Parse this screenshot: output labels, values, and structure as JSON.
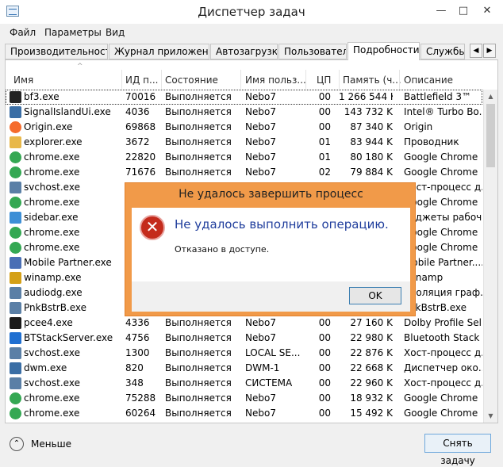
{
  "window": {
    "title": "Диспетчер задач",
    "min_glyph": "—",
    "max_glyph": "□",
    "close_glyph": "✕"
  },
  "menu": [
    "Файл",
    "Параметры",
    "Вид"
  ],
  "tabs": [
    "Производительность",
    "Журнал приложений",
    "Автозагрузка",
    "Пользователи",
    "Подробности",
    "Службы"
  ],
  "active_tab": "Подробности",
  "tab_scroll": {
    "left": "◀",
    "right": "▶"
  },
  "columns": [
    "Имя",
    "ИД п...",
    "Состояние",
    "Имя польз...",
    "ЦП",
    "Память (ч...",
    "Описание"
  ],
  "sort_glyph": "^",
  "rows": [
    {
      "name": "bf3.exe",
      "pid": "70016",
      "state": "Выполняется",
      "user": "Nebo7",
      "cpu": "00",
      "mem": "1 266 544 K",
      "desc": "Battlefield 3™",
      "icon": "bf3-icon",
      "color": "#222222"
    },
    {
      "name": "SignalIslandUi.exe",
      "pid": "4036",
      "state": "Выполняется",
      "user": "Nebo7",
      "cpu": "00",
      "mem": "143 732 K",
      "desc": "Intel® Turbo Bo...",
      "icon": "window-icon",
      "color": "#3a6ea5"
    },
    {
      "name": "Origin.exe",
      "pid": "69868",
      "state": "Выполняется",
      "user": "Nebo7",
      "cpu": "00",
      "mem": "87 340 K",
      "desc": "Origin",
      "icon": "origin-icon",
      "color": "#f56c2d"
    },
    {
      "name": "explorer.exe",
      "pid": "3672",
      "state": "Выполняется",
      "user": "Nebo7",
      "cpu": "01",
      "mem": "83 944 K",
      "desc": "Проводник",
      "icon": "folder-icon",
      "color": "#e8b84a"
    },
    {
      "name": "chrome.exe",
      "pid": "22820",
      "state": "Выполняется",
      "user": "Nebo7",
      "cpu": "01",
      "mem": "80 180 K",
      "desc": "Google Chrome",
      "icon": "chrome-icon",
      "color": "#34a853"
    },
    {
      "name": "chrome.exe",
      "pid": "71676",
      "state": "Выполняется",
      "user": "Nebo7",
      "cpu": "02",
      "mem": "79 884 K",
      "desc": "Google Chrome",
      "icon": "chrome-icon",
      "color": "#34a853"
    },
    {
      "name": "svchost.exe",
      "pid": "",
      "state": "",
      "user": "",
      "cpu": "",
      "mem": "",
      "desc": "Хост-процесс д...",
      "icon": "service-icon",
      "color": "#5a7fa6"
    },
    {
      "name": "chrome.exe",
      "pid": "",
      "state": "",
      "user": "",
      "cpu": "",
      "mem": "",
      "desc": "Google Chrome",
      "icon": "chrome-icon",
      "color": "#34a853"
    },
    {
      "name": "sidebar.exe",
      "pid": "",
      "state": "",
      "user": "",
      "cpu": "",
      "mem": "",
      "desc": "Гаджеты рабоч...",
      "icon": "sidebar-icon",
      "color": "#3d8fd6"
    },
    {
      "name": "chrome.exe",
      "pid": "",
      "state": "",
      "user": "",
      "cpu": "",
      "mem": "",
      "desc": "Google Chrome",
      "icon": "chrome-icon",
      "color": "#34a853"
    },
    {
      "name": "chrome.exe",
      "pid": "",
      "state": "",
      "user": "",
      "cpu": "",
      "mem": "",
      "desc": "Google Chrome",
      "icon": "chrome-icon",
      "color": "#34a853"
    },
    {
      "name": "Mobile Partner.exe",
      "pid": "",
      "state": "",
      "user": "",
      "cpu": "",
      "mem": "",
      "desc": "Mobile Partner....",
      "icon": "mobile-icon",
      "color": "#4a6fb5"
    },
    {
      "name": "winamp.exe",
      "pid": "",
      "state": "",
      "user": "",
      "cpu": "",
      "mem": "",
      "desc": "Winamp",
      "icon": "winamp-icon",
      "color": "#d4a017"
    },
    {
      "name": "audiodg.exe",
      "pid": "",
      "state": "",
      "user": "",
      "cpu": "",
      "mem": "",
      "desc": "Изоляция граф...",
      "icon": "service-icon",
      "color": "#5a7fa6"
    },
    {
      "name": "PnkBstrB.exe",
      "pid": "",
      "state": "",
      "user": "",
      "cpu": "",
      "mem": "",
      "desc": "PnkBstrB.exe",
      "icon": "service-icon",
      "color": "#5a7fa6"
    },
    {
      "name": "pcee4.exe",
      "pid": "4336",
      "state": "Выполняется",
      "user": "Nebo7",
      "cpu": "00",
      "mem": "27 160 K",
      "desc": "Dolby Profile Sel...",
      "icon": "dolby-icon",
      "color": "#1a1a1a"
    },
    {
      "name": "BTStackServer.exe",
      "pid": "4756",
      "state": "Выполняется",
      "user": "Nebo7",
      "cpu": "00",
      "mem": "22 980 K",
      "desc": "Bluetooth Stack ...",
      "icon": "bluetooth-icon",
      "color": "#1f6fd1"
    },
    {
      "name": "svchost.exe",
      "pid": "1300",
      "state": "Выполняется",
      "user": "LOCAL SE...",
      "cpu": "00",
      "mem": "22 876 K",
      "desc": "Хост-процесс д...",
      "icon": "service-icon",
      "color": "#5a7fa6"
    },
    {
      "name": "dwm.exe",
      "pid": "820",
      "state": "Выполняется",
      "user": "DWM-1",
      "cpu": "00",
      "mem": "22 668 K",
      "desc": "Диспетчер око...",
      "icon": "window-icon",
      "color": "#3a6ea5"
    },
    {
      "name": "svchost.exe",
      "pid": "348",
      "state": "Выполняется",
      "user": "СИСТЕМА",
      "cpu": "00",
      "mem": "22 960 K",
      "desc": "Хост-процесс д...",
      "icon": "service-icon",
      "color": "#5a7fa6"
    },
    {
      "name": "chrome.exe",
      "pid": "75288",
      "state": "Выполняется",
      "user": "Nebo7",
      "cpu": "00",
      "mem": "18 932 K",
      "desc": "Google Chrome",
      "icon": "chrome-icon",
      "color": "#34a853"
    },
    {
      "name": "chrome.exe",
      "pid": "60264",
      "state": "Выполняется",
      "user": "Nebo7",
      "cpu": "00",
      "mem": "15 492 K",
      "desc": "Google Chrome",
      "icon": "chrome-icon",
      "color": "#34a853"
    }
  ],
  "scroll": {
    "up": "▲",
    "down": "▼"
  },
  "footer": {
    "less_glyph": "⌃",
    "less_label": "Меньше",
    "end_task": "Снять задачу"
  },
  "dialog": {
    "title": "Не удалось завершить процесс",
    "message": "Не удалось выполнить операцию.",
    "detail": "Отказано в доступе.",
    "ok": "OK",
    "error_glyph": "✕"
  }
}
